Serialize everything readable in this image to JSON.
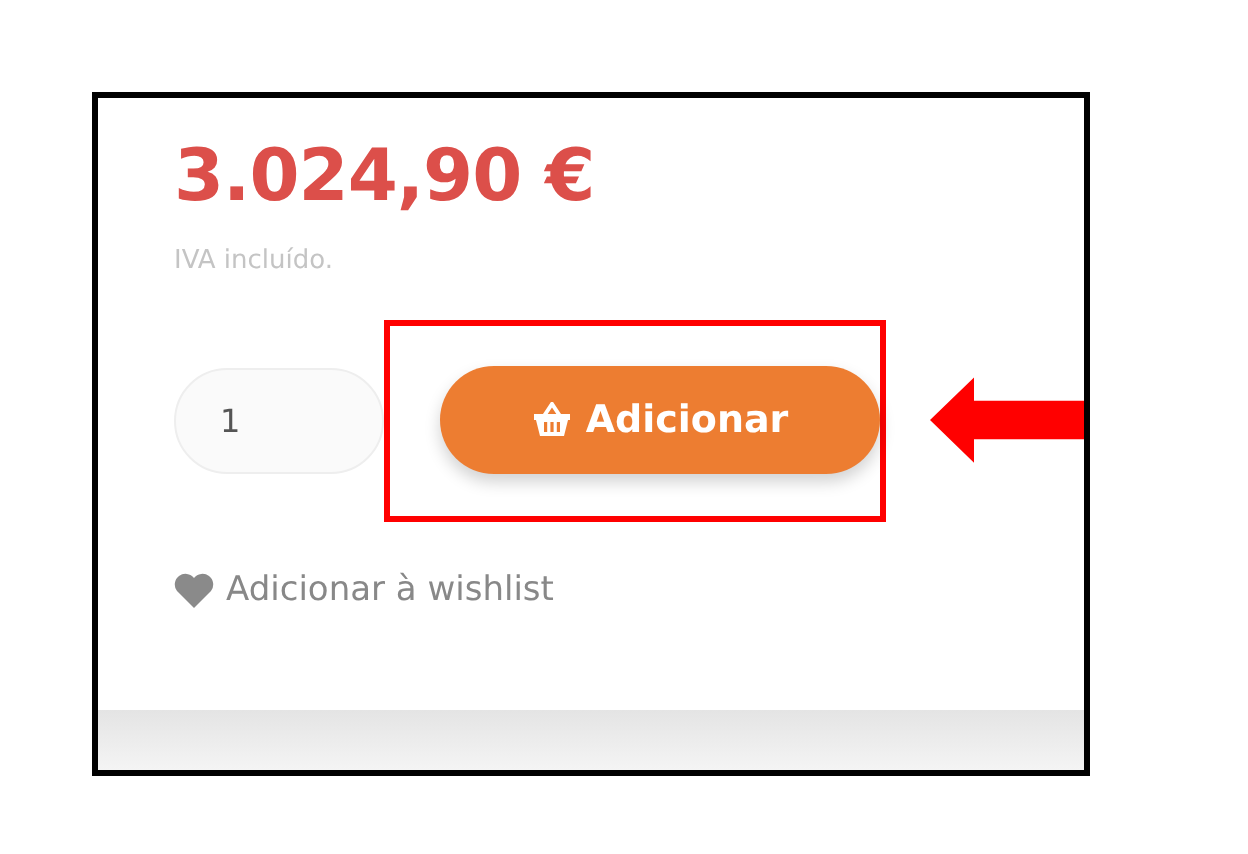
{
  "product": {
    "price": "3.024,90 €",
    "tax_note": "IVA incluído.",
    "quantity": {
      "value": "1"
    },
    "add_button": {
      "label": "Adicionar"
    },
    "wishlist_link": {
      "label": "Adicionar à wishlist"
    }
  }
}
